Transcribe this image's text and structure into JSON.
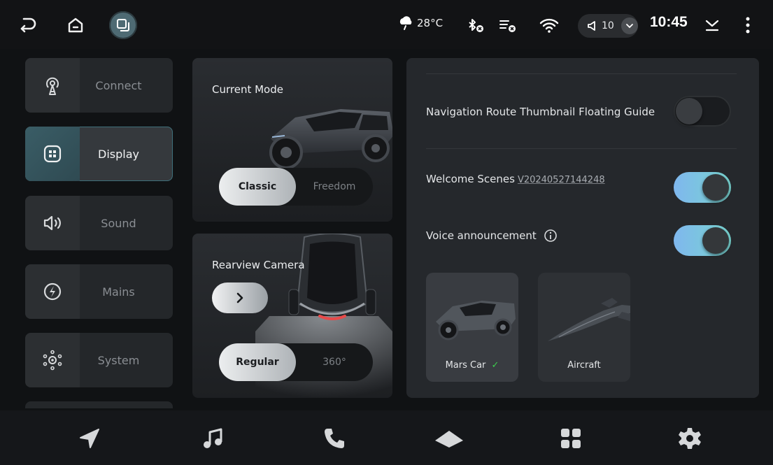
{
  "statusbar": {
    "temperature": "28°C",
    "volume_level": "10",
    "time": "10:45",
    "icons": [
      "back-icon",
      "home-icon",
      "recents-icon",
      "weather-rain-icon",
      "bluetooth-off-icon",
      "data-off-icon",
      "wifi-icon",
      "volume-icon",
      "chevron-down-icon",
      "download-icon",
      "more-icon"
    ]
  },
  "sidebar": {
    "items": [
      {
        "label": "Connect",
        "icon": "signal-tower-icon"
      },
      {
        "label": "Display",
        "icon": "display-grid-icon",
        "active": true
      },
      {
        "label": "Sound",
        "icon": "speaker-icon"
      },
      {
        "label": "Mains",
        "icon": "power-bolt-icon"
      },
      {
        "label": "System",
        "icon": "system-settings-icon"
      }
    ]
  },
  "mode_card": {
    "title": "Current Mode",
    "options": [
      "Classic",
      "Freedom"
    ],
    "selected": "Classic"
  },
  "camera_card": {
    "title": "Rearview Camera",
    "options": [
      "Regular",
      "360°"
    ],
    "selected": "Regular"
  },
  "settings": {
    "nav_guide_label": "Navigation Route Thumbnail Floating Guide",
    "nav_guide_on": false,
    "welcome_label": "Welcome Scenes",
    "welcome_version": "V20240527144248",
    "welcome_on": true,
    "voice_label": "Voice announcement",
    "voice_on": true,
    "scenes": [
      {
        "label": "Mars Car",
        "selected": true
      },
      {
        "label": "Aircraft",
        "selected": false
      }
    ]
  },
  "dock": {
    "icons": [
      "navigation-icon",
      "music-icon",
      "phone-icon",
      "car-home-icon",
      "apps-icon",
      "settings-icon"
    ]
  },
  "colors": {
    "accent_toggle_start": "#7fb7ee",
    "accent_toggle_end": "#78d4d0",
    "active_nav": "#3a5d66",
    "check": "#3ccf4e"
  }
}
